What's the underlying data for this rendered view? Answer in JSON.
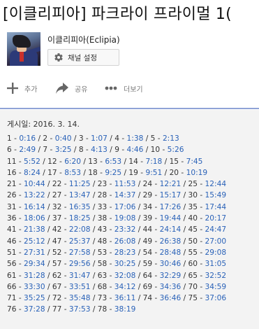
{
  "video": {
    "title": "[이클리피아] 파크라이 프라이멀 1("
  },
  "channel": {
    "name": "이클리피아(Eclipia)",
    "settings_label": "채널 설정"
  },
  "actions": {
    "add": "추가",
    "share": "공유",
    "more": "더보기"
  },
  "description": {
    "published": "게시일: 2016. 3. 14.",
    "lines": [
      [
        [
          "1",
          "0:16"
        ],
        [
          "2",
          "0:40"
        ],
        [
          "3",
          "1:07"
        ],
        [
          "4",
          "1:38"
        ],
        [
          "5",
          "2:13"
        ]
      ],
      [
        [
          "6",
          "2:49"
        ],
        [
          "7",
          "3:25"
        ],
        [
          "8",
          "4:13"
        ],
        [
          "9",
          "4:46"
        ],
        [
          "10",
          "5:26"
        ]
      ],
      [
        [
          "11",
          "5:52"
        ],
        [
          "12",
          "6:20"
        ],
        [
          "13",
          "6:53"
        ],
        [
          "14",
          "7:18"
        ],
        [
          "15",
          "7:45"
        ]
      ],
      [
        [
          "16",
          "8:24"
        ],
        [
          "17",
          "8:53"
        ],
        [
          "18",
          "9:25"
        ],
        [
          "19",
          "9:51"
        ],
        [
          "20",
          "10:19"
        ]
      ],
      [
        [
          "21",
          "10:44"
        ],
        [
          "22",
          "11:25"
        ],
        [
          "23",
          "11:53"
        ],
        [
          "24",
          "12:21"
        ],
        [
          "25",
          "12:44"
        ]
      ],
      [
        [
          "26",
          "13:22"
        ],
        [
          "27",
          "13:47"
        ],
        [
          "28",
          "14:37"
        ],
        [
          "29",
          "15:17"
        ],
        [
          "30",
          "15:49"
        ]
      ],
      [
        [
          "31",
          "16:14"
        ],
        [
          "32",
          "16:35"
        ],
        [
          "33",
          "17:06"
        ],
        [
          "34",
          "17:26"
        ],
        [
          "35",
          "17:44"
        ]
      ],
      [
        [
          "36",
          "18:06"
        ],
        [
          "37",
          "18:25"
        ],
        [
          "38",
          "19:08"
        ],
        [
          "39",
          "19:44"
        ],
        [
          "40",
          "20:17"
        ]
      ],
      [
        [
          "41",
          "21:38"
        ],
        [
          "42",
          "22:08"
        ],
        [
          "43",
          "23:32"
        ],
        [
          "44",
          "24:14"
        ],
        [
          "45",
          "24:47"
        ]
      ],
      [
        [
          "46",
          "25:12"
        ],
        [
          "47",
          "25:37"
        ],
        [
          "48",
          "26:08"
        ],
        [
          "49",
          "26:38"
        ],
        [
          "50",
          "27:00"
        ]
      ],
      [
        [
          "51",
          "27:31"
        ],
        [
          "52",
          "27:58"
        ],
        [
          "53",
          "28:23"
        ],
        [
          "54",
          "28:48"
        ],
        [
          "55",
          "29:08"
        ]
      ],
      [
        [
          "56",
          "29:34"
        ],
        [
          "57",
          "29:56"
        ],
        [
          "58",
          "30:25"
        ],
        [
          "59",
          "30:46"
        ],
        [
          "60",
          "31:05"
        ]
      ],
      [
        [
          "61",
          "31:28"
        ],
        [
          "62",
          "31:47"
        ],
        [
          "63",
          "32:08"
        ],
        [
          "64",
          "32:29"
        ],
        [
          "65",
          "32:52"
        ]
      ],
      [
        [
          "66",
          "33:30"
        ],
        [
          "67",
          "33:51"
        ],
        [
          "68",
          "34:12"
        ],
        [
          "69",
          "34:36"
        ],
        [
          "70",
          "34:59"
        ]
      ],
      [
        [
          "71",
          "35:25"
        ],
        [
          "72",
          "35:48"
        ],
        [
          "73",
          "36:11"
        ],
        [
          "74",
          "36:46"
        ],
        [
          "75",
          "37:06"
        ]
      ],
      [
        [
          "76",
          "37:28"
        ],
        [
          "77",
          "37:53"
        ],
        [
          "78",
          "38:19"
        ]
      ]
    ]
  },
  "colors": {
    "link": "#2a62b8",
    "divider": "#8fa3d6",
    "description_bg": "#f3f3f3"
  },
  "icons": {
    "add": "plus-icon",
    "share": "share-arrow-icon",
    "more": "more-dots-icon",
    "settings": "gear-icon"
  }
}
